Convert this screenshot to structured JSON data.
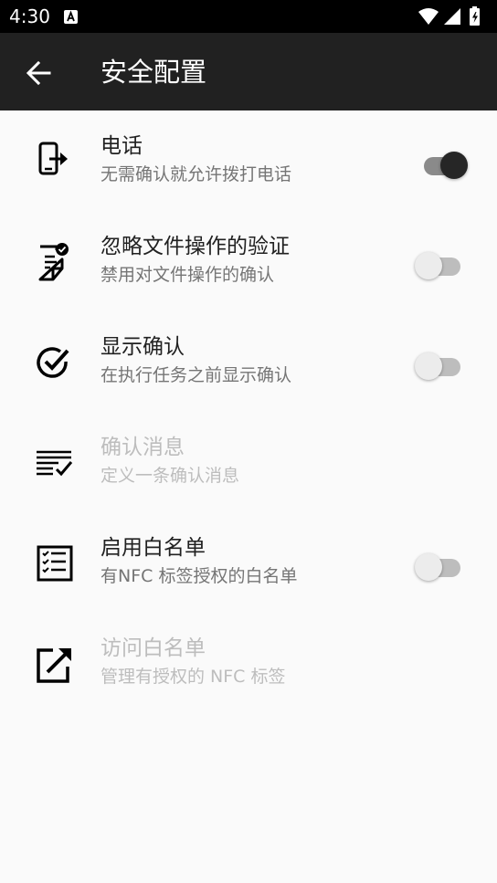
{
  "status_bar": {
    "time": "4:30"
  },
  "toolbar": {
    "title": "安全配置"
  },
  "items": [
    {
      "title": "电话",
      "subtitle": "无需确认就允许拨打电话",
      "switch": true,
      "icon": "phone-forward-icon"
    },
    {
      "title": "忽略文件操作的验证",
      "subtitle": "禁用对文件操作的确认",
      "switch": false,
      "icon": "file-check-icon"
    },
    {
      "title": "显示确认",
      "subtitle": "在执行任务之前显示确认",
      "switch": false,
      "icon": "check-circle-icon"
    },
    {
      "title": "确认消息",
      "subtitle": "定义一条确认消息",
      "disabled": true,
      "icon": "text-check-icon"
    },
    {
      "title": "启用白名单",
      "subtitle": "有NFC 标签授权的白名单",
      "switch": false,
      "icon": "checklist-icon"
    },
    {
      "title": "访问白名单",
      "subtitle": "管理有授权的 NFC 标签",
      "disabled": true,
      "icon": "open-external-icon"
    }
  ],
  "colors": {
    "toolbar": "#212121",
    "background": "#fafafa",
    "switch_on_thumb": "#262626"
  }
}
